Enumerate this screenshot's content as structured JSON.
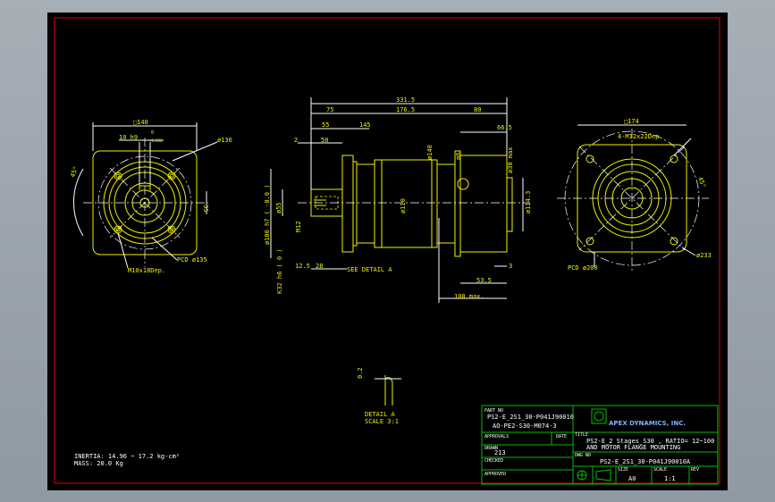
{
  "drawing": {
    "front_view": {
      "square": "□140",
      "key_width": "10 h9",
      "key_height_value": "0",
      "key_height_tol": "-0.036",
      "pilot": "ø136",
      "dim_side": "35",
      "pcd": "PCD ø135",
      "holes": "M10x18Dep.",
      "angle": "45°"
    },
    "side_view": {
      "overall": "331.5",
      "d75": "75",
      "d176": "176.5",
      "d80": "80",
      "d55": "55",
      "d145": "145",
      "d2": "2",
      "d50": "50",
      "d665": "66.5",
      "d28": "28",
      "d125": "12.5",
      "d3": "3",
      "d535": "53.5",
      "d108": "108 max.",
      "d30max": "ø30 max",
      "d140": "ø140",
      "d110": "ø110",
      "d1143": "ø114.3",
      "d6": "ø6",
      "d100": "ø100 h7 ( -0.0 )",
      "d55r": "ø55",
      "m12": "M12",
      "key32": "K32 h6 ( 0 )",
      "see_detail": "SEE DETAIL A"
    },
    "motor_view": {
      "square": "□174",
      "holes": "4-M12x22Dep.",
      "angle": "45°",
      "pcd": "PCD ø200",
      "d233": "ø233"
    },
    "detail": {
      "label": "DETAIL A",
      "scale": "SCALE 3:1",
      "dim": "0.2"
    },
    "notes": {
      "inertia": "INERTIA: 14.96 ~ 17.2 kg-cm²",
      "mass": "MASS: 20.0 Kg"
    }
  },
  "title_block": {
    "part_no_label": "PART NO",
    "part_no_1": "PS2-E_2S1_30-P041J90010",
    "part_no_2": "AO-PE2-S30-M074-3",
    "company": "APEX DYNAMICS, INC.",
    "approvals_label": "APPROVALS",
    "date_label": "DATE",
    "title_label": "TITLE",
    "title_1": "PS2-E_2 Stages_S30 , RATIO= 12~100",
    "title_2": "AND MOTOR FLANGE MOUNTING",
    "drawn_label": "DRAWN",
    "drawn_value": "213",
    "checked_label": "CHECKED",
    "dwg_no_label": "DWG NO",
    "dwg_no": "PS2-E_2S1_30-P041J90010A",
    "approved_label": "APPROVED",
    "size_label": "SIZE",
    "size_value": "A0",
    "scale_label": "SCALE",
    "scale_value": "1:1",
    "rev_label": "REV"
  }
}
